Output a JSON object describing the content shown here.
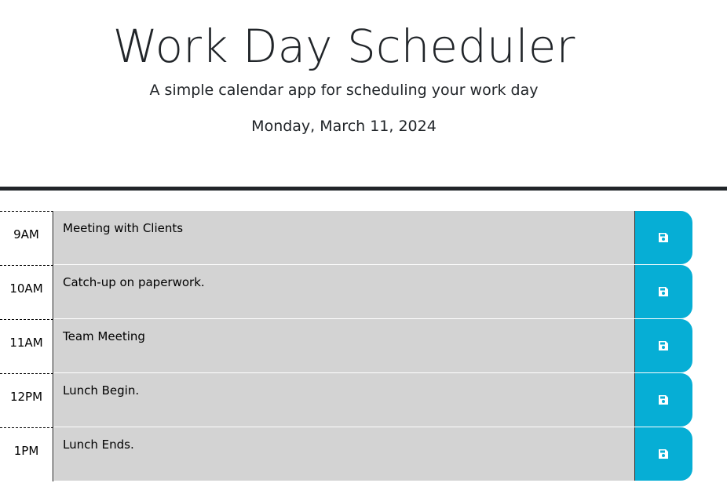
{
  "header": {
    "title": "Work Day Scheduler",
    "subtitle": "A simple calendar app for scheduling your work day",
    "current_day": "Monday, March 11, 2024"
  },
  "colors": {
    "past": "#d3d3d3",
    "save_button": "#06aed5",
    "divider": "#212529"
  },
  "time_blocks": [
    {
      "hour": "9AM",
      "description": "Meeting with Clients",
      "save_icon": "save-icon"
    },
    {
      "hour": "10AM",
      "description": "Catch-up on paperwork.",
      "save_icon": "save-icon"
    },
    {
      "hour": "11AM",
      "description": "Team Meeting",
      "save_icon": "save-icon"
    },
    {
      "hour": "12PM",
      "description": "Lunch Begin.",
      "save_icon": "save-icon"
    },
    {
      "hour": "1PM",
      "description": "Lunch Ends.",
      "save_icon": "save-icon"
    }
  ]
}
